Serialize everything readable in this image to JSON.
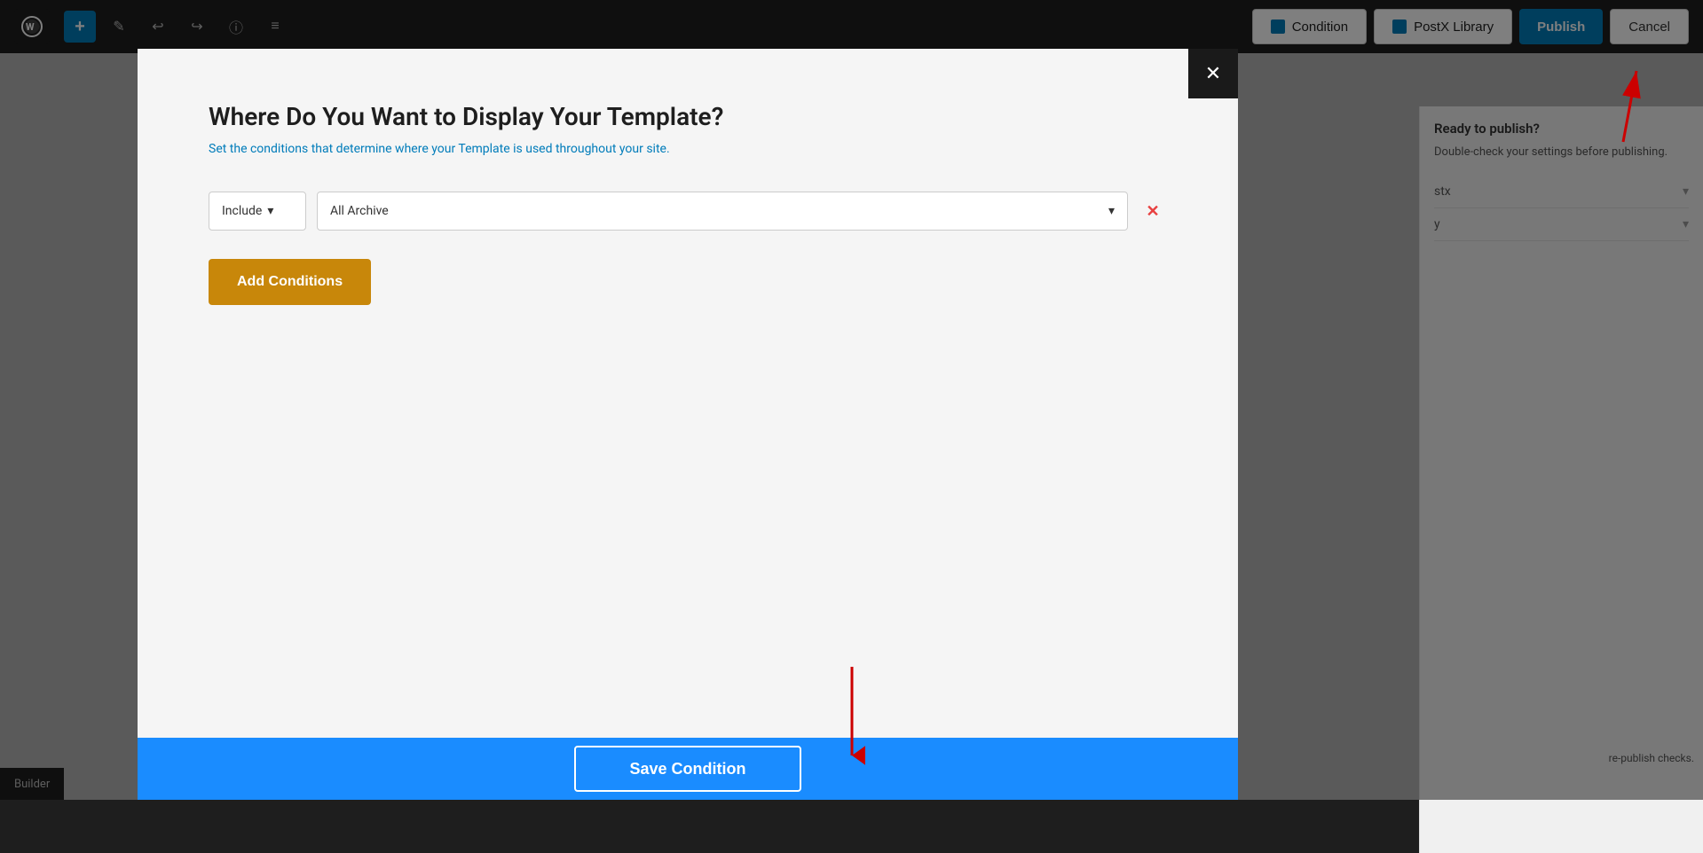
{
  "toolbar": {
    "wp_logo": "W",
    "add_label": "+",
    "undo_label": "↩",
    "redo_label": "↪",
    "info_label": "ⓘ",
    "list_label": "≡",
    "condition_label": "Condition",
    "postx_label": "PostX Library",
    "publish_label": "Publish",
    "cancel_label": "Cancel"
  },
  "right_panel": {
    "title": "Ready to publish?",
    "subtitle": "Double-check your settings before publishing.",
    "item1_label": "stx",
    "item2_label": "y"
  },
  "modal": {
    "close_label": "✕",
    "title": "Where Do You Want to Display Your Template?",
    "subtitle_text": "Set the conditions that determine where your ",
    "subtitle_link": "Template",
    "subtitle_end": " is used throughout your site.",
    "include_label": "Include",
    "include_chevron": "▾",
    "archive_label": "All Archive",
    "archive_chevron": "▾",
    "delete_label": "✕",
    "add_conditions_label": "Add Conditions",
    "save_condition_label": "Save Condition"
  },
  "bottom_bar": {
    "label": "Builder"
  }
}
